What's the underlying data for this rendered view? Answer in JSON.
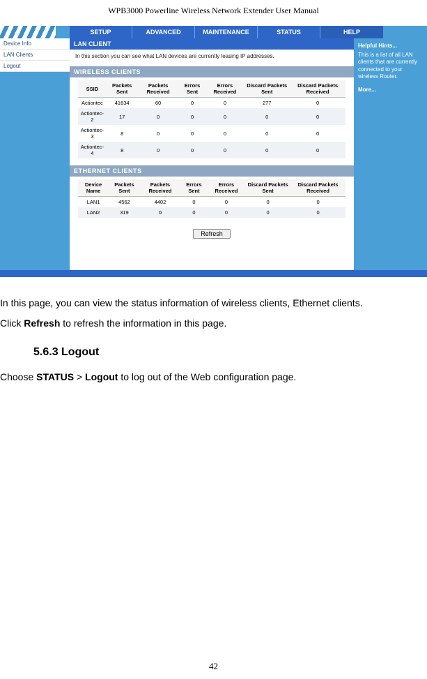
{
  "doc": {
    "header_model": "WPB3000",
    "header_rest": " Powerline Wireless Network Extender User Manual",
    "page_number": "42"
  },
  "router_ui": {
    "tabs": [
      "SETUP",
      "ADVANCED",
      "MAINTENANCE",
      "STATUS",
      "HELP"
    ],
    "left_nav": [
      "Device Info",
      "LAN Clients",
      "Logout"
    ],
    "section_lan_client_title": "LAN CLIENT",
    "section_lan_client_desc": "In this section you can see what LAN devices are currently leasing IP addresses.",
    "wireless_title": "WIRELESS CLIENTS",
    "ethernet_title": "ETHERNET CLIENTS",
    "wireless_headers": [
      "SSID",
      "Packets Sent",
      "Packets Received",
      "Errors Sent",
      "Errors Received",
      "Discard Packets Sent",
      "Discard Packets Received"
    ],
    "wireless_rows": [
      [
        "Actiontec",
        "41634",
        "60",
        "0",
        "0",
        "277",
        "0"
      ],
      [
        "Actiontec-2",
        "17",
        "0",
        "0",
        "0",
        "0",
        "0"
      ],
      [
        "Actiontec-3",
        "8",
        "0",
        "0",
        "0",
        "0",
        "0"
      ],
      [
        "Actiontec-4",
        "8",
        "0",
        "0",
        "0",
        "0",
        "0"
      ]
    ],
    "ethernet_headers": [
      "Device Name",
      "Packets Sent",
      "Packets Received",
      "Errors Sent",
      "Errors Received",
      "Discard Packets Sent",
      "Discard Packets Received"
    ],
    "ethernet_rows": [
      [
        "LAN1",
        "4562",
        "4402",
        "0",
        "0",
        "0",
        "0"
      ],
      [
        "LAN2",
        "319",
        "0",
        "0",
        "0",
        "0",
        "0"
      ]
    ],
    "refresh_label": "Refresh",
    "help": {
      "title": "Helpful Hints...",
      "body": "This is a list of all LAN clients that are currently connected to your wireless Router.",
      "more": "More..."
    }
  },
  "body": {
    "p1_a": "In this page, you can view the status information of wireless clients, Ethernet clients.",
    "p2_a": "Click ",
    "p2_bold": "Refresh",
    "p2_b": " to refresh the information in this page.",
    "heading": "5.6.3  Logout",
    "p3_a": "Choose ",
    "p3_bold1": "STATUS",
    "p3_mid": " > ",
    "p3_bold2": "Logout",
    "p3_b": " to log out of the Web configuration page."
  }
}
